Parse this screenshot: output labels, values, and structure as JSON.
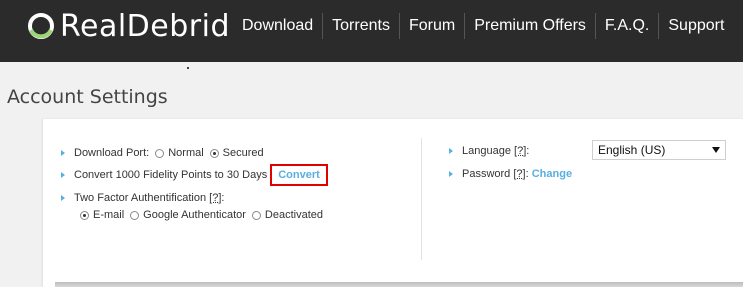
{
  "header": {
    "logo_text": "RealDebrid",
    "nav": [
      "Download",
      "Torrents",
      "Forum",
      "Premium Offers",
      "F.A.Q.",
      "Support"
    ]
  },
  "page": {
    "title": "Account Settings"
  },
  "settings": {
    "download_port": {
      "label": "Download Port:",
      "options": [
        "Normal",
        "Secured"
      ],
      "selected": "Secured"
    },
    "fidelity": {
      "text": "Convert 1000 Fidelity Points to 30 Days",
      "action": "Convert"
    },
    "two_factor": {
      "label": "Two Factor Authentification",
      "help": "[?]",
      "suffix": " :",
      "options": [
        "E-mail",
        "Google Authenticator",
        "Deactivated"
      ],
      "selected": "E-mail"
    },
    "language": {
      "label": "Language",
      "help": "[?]",
      "suffix": " :",
      "value": "English (US)"
    },
    "password": {
      "label": "Password",
      "help": "[?]",
      "suffix": ":",
      "action": "Change"
    }
  },
  "colors": {
    "header_bg": "#2b2b2b",
    "accent": "#5aaee0",
    "highlight": "#e10000"
  }
}
